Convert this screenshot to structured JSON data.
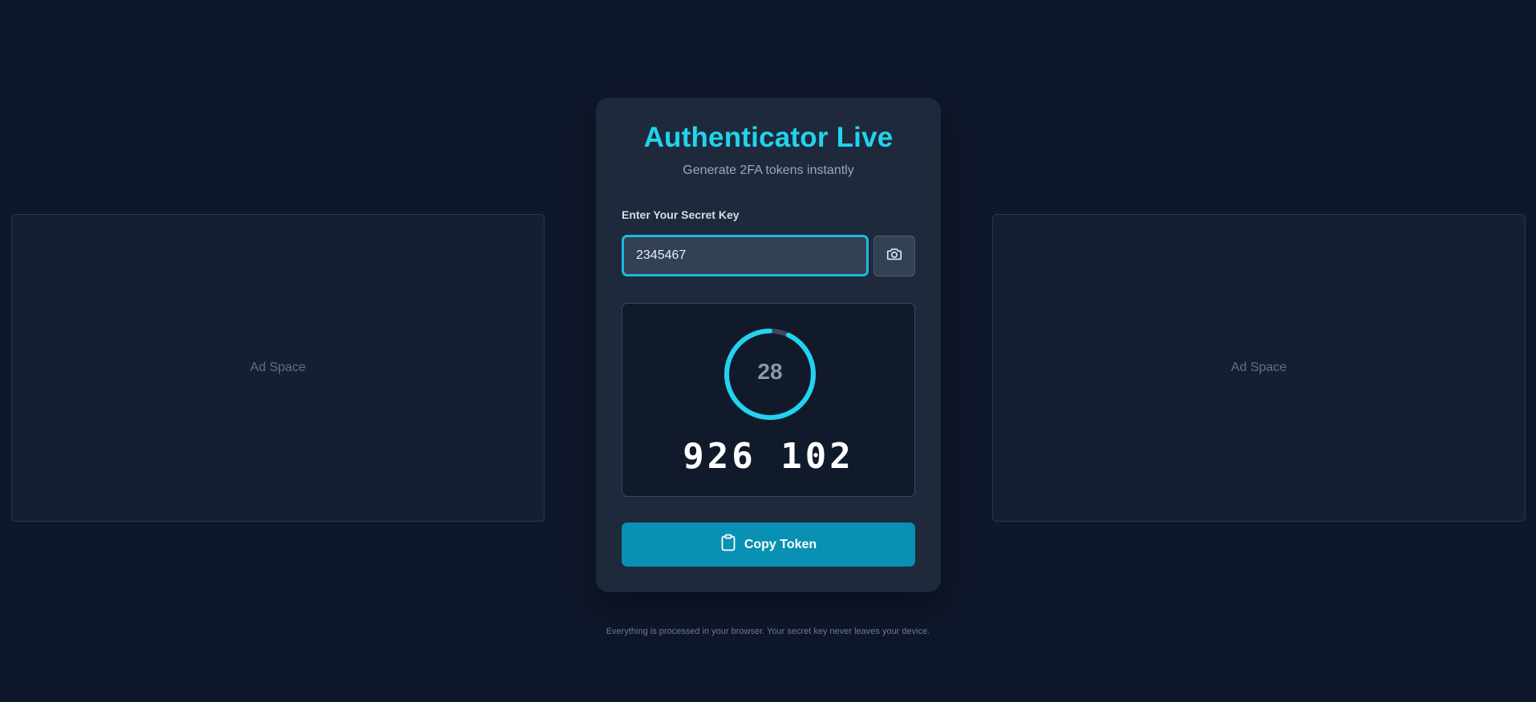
{
  "ads": {
    "left_label": "Ad Space",
    "right_label": "Ad Space"
  },
  "app": {
    "title": "Authenticator Live",
    "subtitle": "Generate 2FA tokens instantly"
  },
  "secret": {
    "label": "Enter Your Secret Key",
    "value": "2345467"
  },
  "timer": {
    "seconds_remaining": "28",
    "progress_fraction": 0.93
  },
  "token": {
    "code": "926 102"
  },
  "actions": {
    "copy_label": "Copy Token"
  },
  "footer": {
    "text": "Everything is processed in your browser. Your secret key never leaves your device."
  },
  "icons": {
    "camera": "camera-icon",
    "clipboard": "clipboard-icon"
  },
  "colors": {
    "accent": "#22d3ee",
    "button": "#0891b2",
    "background": "#0f172a",
    "card": "#1e293b"
  }
}
